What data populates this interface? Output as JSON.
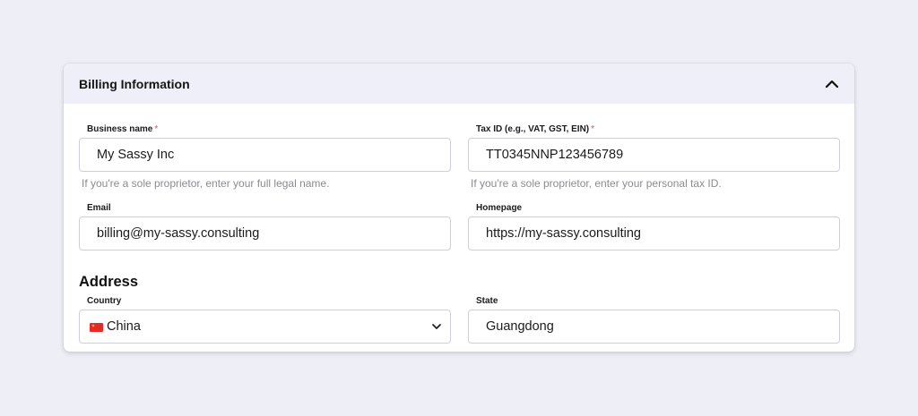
{
  "card": {
    "title": "Billing Information",
    "collapse_icon": "chevron-up-icon"
  },
  "fields": {
    "business_name": {
      "label": "Business name",
      "required_marker": "*",
      "value": "My Sassy Inc",
      "hint": "If you're a sole proprietor, enter your full legal name."
    },
    "tax_id": {
      "label": "Tax ID (e.g., VAT, GST, EIN)",
      "required_marker": "*",
      "value": "TT0345NNP123456789",
      "hint": "If you're a sole proprietor, enter your personal tax ID."
    },
    "email": {
      "label": "Email",
      "value": "billing@my-sassy.consulting"
    },
    "homepage": {
      "label": "Homepage",
      "value": "https://my-sassy.consulting"
    }
  },
  "address": {
    "title": "Address",
    "country": {
      "label": "Country",
      "value": "China",
      "flag_icon": "china-flag-icon",
      "dropdown_icon": "chevron-down-icon"
    },
    "state": {
      "label": "State",
      "value": "Guangdong"
    }
  },
  "colors": {
    "page_background": "#eeeff6",
    "header_background": "#eeeff8",
    "required_marker": "#d9534f",
    "hint_text": "#8b8b92",
    "input_border": "#cfcfd6"
  }
}
